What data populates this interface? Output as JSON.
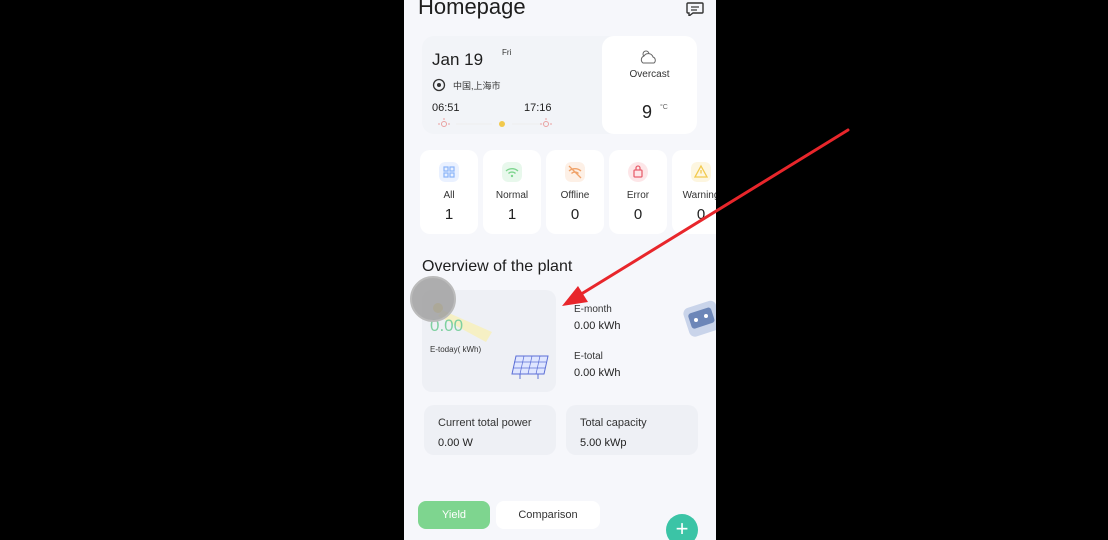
{
  "header": {
    "title": "Homepage"
  },
  "weather": {
    "date": "Jan 19",
    "day_of_week": "Fri",
    "location": "中国,上海市",
    "sunrise": "06:51",
    "sunset": "17:16",
    "condition": "Overcast",
    "temperature": "9",
    "temperature_unit": "°C"
  },
  "device_status": [
    {
      "label": "All",
      "count": "1",
      "color": "#8ab4f8"
    },
    {
      "label": "Normal",
      "count": "1",
      "color": "#7ed58f"
    },
    {
      "label": "Offline",
      "count": "0",
      "color": "#f0a36a"
    },
    {
      "label": "Error",
      "count": "0",
      "color": "#e8616e"
    },
    {
      "label": "Warning",
      "count": "0",
      "color": "#f2c94c"
    }
  ],
  "overview": {
    "title": "Overview of the plant",
    "today_value": "0.00",
    "today_label": "E-today( kWh)",
    "emonth_label": "E-month",
    "emonth_value": "0.00 kWh",
    "etotal_label": "E-total",
    "etotal_value": "0.00 kWh"
  },
  "power": {
    "current_label": "Current total power",
    "current_value": "0.00 W",
    "capacity_label": "Total capacity",
    "capacity_value": "5.00 kWp"
  },
  "tabs": {
    "yield": "Yield",
    "comparison": "Comparison"
  },
  "fab": {
    "label": "+"
  },
  "colors": {
    "accent": "#7ed58f",
    "annotation_arrow": "#e8262b"
  }
}
